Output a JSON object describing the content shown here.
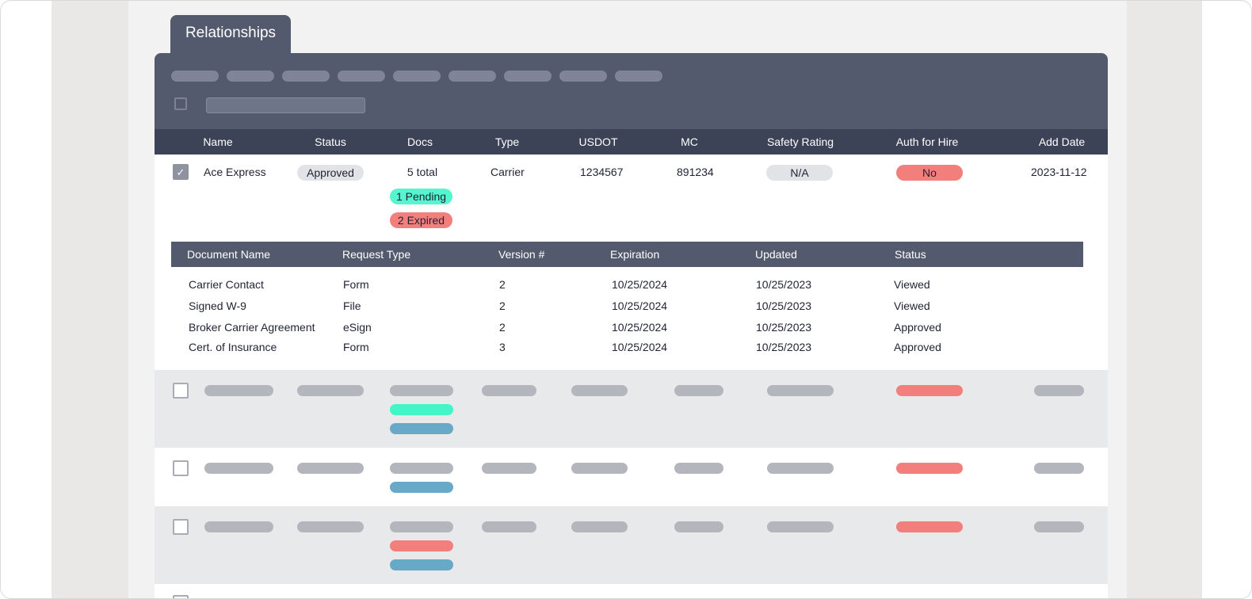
{
  "tab": {
    "label": "Relationships"
  },
  "columns": [
    "Name",
    "Status",
    "Docs",
    "Type",
    "USDOT",
    "MC",
    "Safety Rating",
    "Auth for Hire",
    "Add Date"
  ],
  "row": {
    "checked": true,
    "name": "Ace Express",
    "status": "Approved",
    "docs_total": "5 total",
    "docs_pending": "1 Pending",
    "docs_expired": "2 Expired",
    "type": "Carrier",
    "usdot": "1234567",
    "mc": "891234",
    "safety_rating": "N/A",
    "auth_for_hire": "No",
    "add_date": "2023-11-12"
  },
  "documents": {
    "columns": [
      "Document Name",
      "Request Type",
      "Version #",
      "Expiration",
      "Updated",
      "Status"
    ],
    "rows": [
      [
        "Carrier Contact",
        "Form",
        "2",
        "10/25/2024",
        "10/25/2023",
        "Viewed"
      ],
      [
        "Signed W-9",
        "File",
        "2",
        "10/25/2024",
        "10/25/2023",
        "Viewed"
      ],
      [
        "Broker Carrier Agreement",
        "eSign",
        "2",
        "10/25/2024",
        "10/25/2023",
        "Approved"
      ],
      [
        "Cert. of Insurance",
        "Form",
        "3",
        "10/25/2024",
        "10/25/2023",
        "Approved"
      ]
    ]
  },
  "colors": {
    "toolbar": "#535a6e",
    "header": "#3d4356",
    "status_red": "#f37f7d",
    "status_teal": "#55f5cd",
    "status_blue": "#68a9c8",
    "skeleton": "#b4b6bd"
  },
  "icons": {
    "checkbox_check": "check-icon"
  }
}
